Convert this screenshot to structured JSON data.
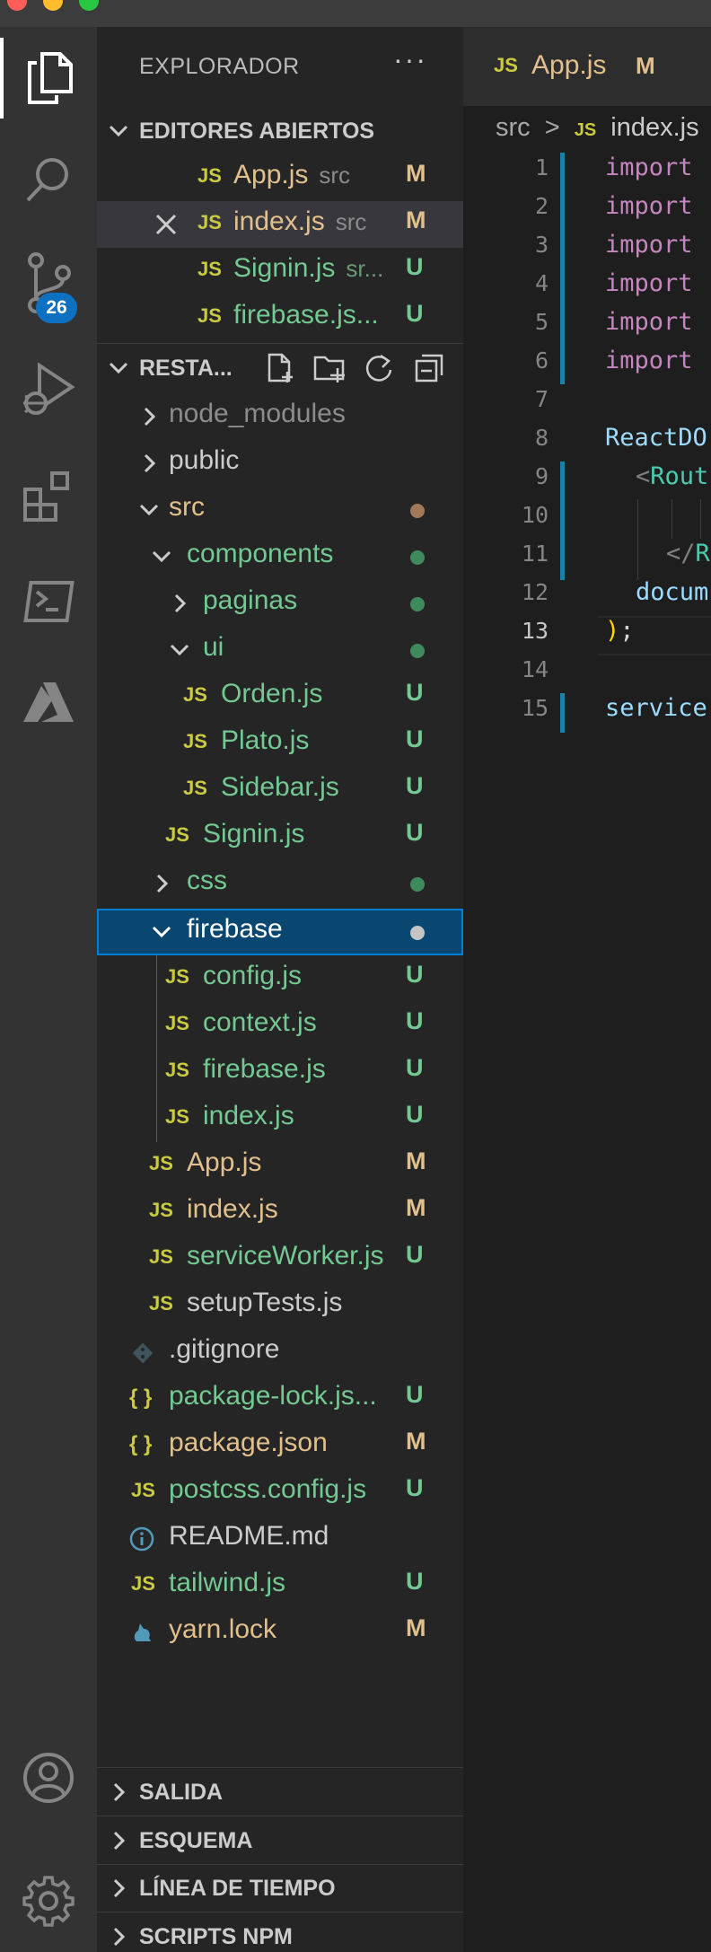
{
  "explorer": {
    "title": "EXPLORADOR",
    "more": "···",
    "open_editors": {
      "label": "EDITORES ABIERTOS",
      "items": [
        {
          "icon": "JS",
          "name": "App.js",
          "desc": "src",
          "status": "M"
        },
        {
          "icon": "JS",
          "name": "index.js",
          "desc": "src",
          "status": "M"
        },
        {
          "icon": "JS",
          "name": "Signin.js",
          "desc": "sr...",
          "status": "U"
        },
        {
          "icon": "JS",
          "name": "firebase.js...",
          "desc": "",
          "status": "U"
        }
      ]
    },
    "project": {
      "label": "RESTA...",
      "tree": [
        {
          "icon": "",
          "name": "node_modules",
          "status": ""
        },
        {
          "icon": "",
          "name": "public",
          "status": ""
        },
        {
          "icon": "",
          "name": "src",
          "status": ""
        },
        {
          "icon": "",
          "name": "components",
          "status": ""
        },
        {
          "icon": "",
          "name": "paginas",
          "status": ""
        },
        {
          "icon": "",
          "name": "ui",
          "status": ""
        },
        {
          "icon": "JS",
          "name": "Orden.js",
          "status": "U"
        },
        {
          "icon": "JS",
          "name": "Plato.js",
          "status": "U"
        },
        {
          "icon": "JS",
          "name": "Sidebar.js",
          "status": "U"
        },
        {
          "icon": "JS",
          "name": "Signin.js",
          "status": "U"
        },
        {
          "icon": "",
          "name": "css",
          "status": ""
        },
        {
          "icon": "",
          "name": "firebase",
          "status": ""
        },
        {
          "icon": "JS",
          "name": "config.js",
          "status": "U"
        },
        {
          "icon": "JS",
          "name": "context.js",
          "status": "U"
        },
        {
          "icon": "JS",
          "name": "firebase.js",
          "status": "U"
        },
        {
          "icon": "JS",
          "name": "index.js",
          "status": "U"
        },
        {
          "icon": "JS",
          "name": "App.js",
          "status": "M"
        },
        {
          "icon": "JS",
          "name": "index.js",
          "status": "M"
        },
        {
          "icon": "JS",
          "name": "serviceWorker.js",
          "status": "U"
        },
        {
          "icon": "JS",
          "name": "setupTests.js",
          "status": ""
        },
        {
          "icon": "git-icon",
          "name": ".gitignore",
          "status": ""
        },
        {
          "icon": "{ }",
          "name": "package-lock.js...",
          "status": "U"
        },
        {
          "icon": "{ }",
          "name": "package.json",
          "status": "M"
        },
        {
          "icon": "JS",
          "name": "postcss.config.js",
          "status": "U"
        },
        {
          "icon": "info-icon",
          "name": "README.md",
          "status": ""
        },
        {
          "icon": "JS",
          "name": "tailwind.js",
          "status": "U"
        },
        {
          "icon": "yarn-icon",
          "name": "yarn.lock",
          "status": "M"
        }
      ]
    },
    "panels": [
      "SALIDA",
      "ESQUEMA",
      "LÍNEA DE TIEMPO",
      "SCRIPTS NPM"
    ]
  },
  "activity_bar": {
    "scm_badge": "26"
  },
  "editor": {
    "tab": {
      "icon": "JS",
      "name": "App.js",
      "status": "M"
    },
    "breadcrumb": {
      "folder": "src",
      "sep": ">",
      "icon": "JS",
      "file": "index.js"
    },
    "line_numbers": [
      "1",
      "2",
      "3",
      "4",
      "5",
      "6",
      "7",
      "8",
      "9",
      "10",
      "11",
      "12",
      "13",
      "14",
      "15"
    ],
    "lines": {
      "l1": "import",
      "l2": "import",
      "l3": "import",
      "l4": "import",
      "l5": "import",
      "l6": "import",
      "l8": "ReactDO",
      "l9_open": "<",
      "l9_tag": "Rout",
      "l11_open": "</",
      "l11_tag": "R",
      "l12": "docum",
      "l13_paren": ")",
      "l13_semi": ";",
      "l15": "service"
    }
  },
  "colors": {
    "modified": "#e2c08d",
    "untracked": "#73c991",
    "js_icon": "#cbcb41",
    "selection": "#094771",
    "badge": "#0e70c0"
  }
}
